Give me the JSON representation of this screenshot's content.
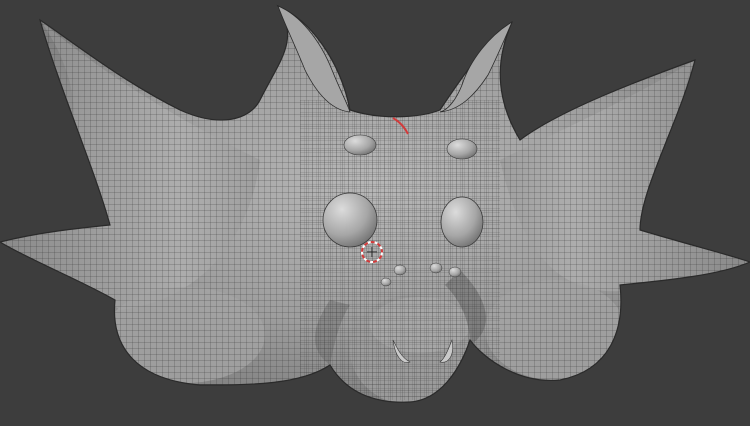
{
  "app": {
    "name": "",
    "mode": "",
    "viewport_label": ""
  },
  "viewport": {
    "background_color": "#3d3d3d",
    "mesh_base_color": "#a9a9a9",
    "mesh_shadow_color": "#6e6e6e",
    "wire_color": "#2a2a2a",
    "accent_color": "#d23a3a",
    "objects": [
      {
        "name": "",
        "type": "sculpt-mesh",
        "features": [
          "horns",
          "ears",
          "eyes",
          "nose",
          "fangs"
        ]
      }
    ],
    "cursor": {
      "type": "3d-cursor",
      "color": "#d23a3a"
    }
  }
}
